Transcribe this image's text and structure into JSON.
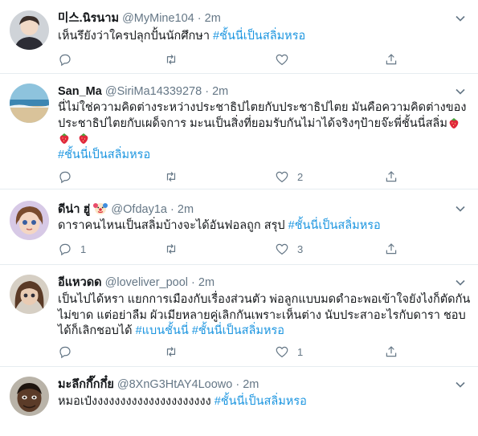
{
  "tweets": [
    {
      "name": "미스.นิรนาม",
      "handle": "@MyMine104",
      "dot": "·",
      "time": "2m",
      "text": "เห็นรึยังว่าใครปลุกปั้นนักศึกษา",
      "hashtag": "#ชั้นนี่เป็นสลิ่มหรอ",
      "reply_count": "",
      "retweet_count": "",
      "like_count": ""
    },
    {
      "name": "San_Ma",
      "handle": "@SiriMa14339278",
      "dot": "·",
      "time": "2m",
      "text_line1": "นี่ไม่ใช่ความคิดต่างระหว่างประชาธิปไตยกับประชาธิปไตย มันคือความคิดต่างของ",
      "text_line2": "ประชาธิปไตยกับเผด็จการ  มะนเป็นสิ่งที่ยอมรับกันไม่าได้จริงๆป้ายจ๊ะพี่ชั้นนี่สลิ่ม",
      "hashtag": "#ชั้นนี่เป็นสลิ่มหรอ",
      "reply_count": "",
      "retweet_count": "",
      "like_count": "2"
    },
    {
      "name": "ดีน่า ฮู่",
      "handle": "@Ofday1a",
      "dot": "·",
      "time": "2m",
      "text": "ดาราคนไหนเป็นสลิ่มบ้างจะได้อันฟอลถูก สรุป",
      "hashtag": "#ชั้นนี่เป็นสลิ่มหรอ",
      "reply_count": "1",
      "retweet_count": "",
      "like_count": "3"
    },
    {
      "name": "อีแหวดด",
      "handle": "@loveliver_pool",
      "dot": "·",
      "time": "2m",
      "text_line1": "เป็นไปได้หรา แยกการเมืองกับเรื่องส่วนตัว พ่อลูกแบบมดดำอะพอเข้าใจยังไงก็ตัดกัน",
      "text_line2": "ไม่ขาด แต่อย่าลืม ผัวเมียหลายคู่เลิกกันเพราะเห็นต่าง นับประสาอะไรกับดารา ชอบ",
      "text_line3": "ได้ก็เลิกชอบได้",
      "hashtag": "#แบนชั้นนี่",
      "hashtag2": "#ชั้นนี่เป็นสลิ่มหรอ",
      "reply_count": "",
      "retweet_count": "",
      "like_count": "1"
    },
    {
      "name": "มะลึกกึ๊กกึ๋ย",
      "handle": "@8XnG3HtAY4Loowo",
      "dot": "·",
      "time": "2m",
      "text": "หมอเป๋งงงงงงงงงงงงงงงงงงงงง",
      "hashtag": "#ชั้นนี่เป็นสลิ่มหรอ"
    }
  ],
  "icons": {
    "reply": "reply-icon",
    "retweet": "retweet-icon",
    "like": "like-icon",
    "share": "share-icon",
    "caret": "chevron-down-icon",
    "strawberry": "strawberry-emoji",
    "clown": "clown-emoji"
  },
  "colors": {
    "link": "#1b95e0",
    "muted": "#657786",
    "text": "#14171a",
    "divider": "#e6ecf0"
  }
}
